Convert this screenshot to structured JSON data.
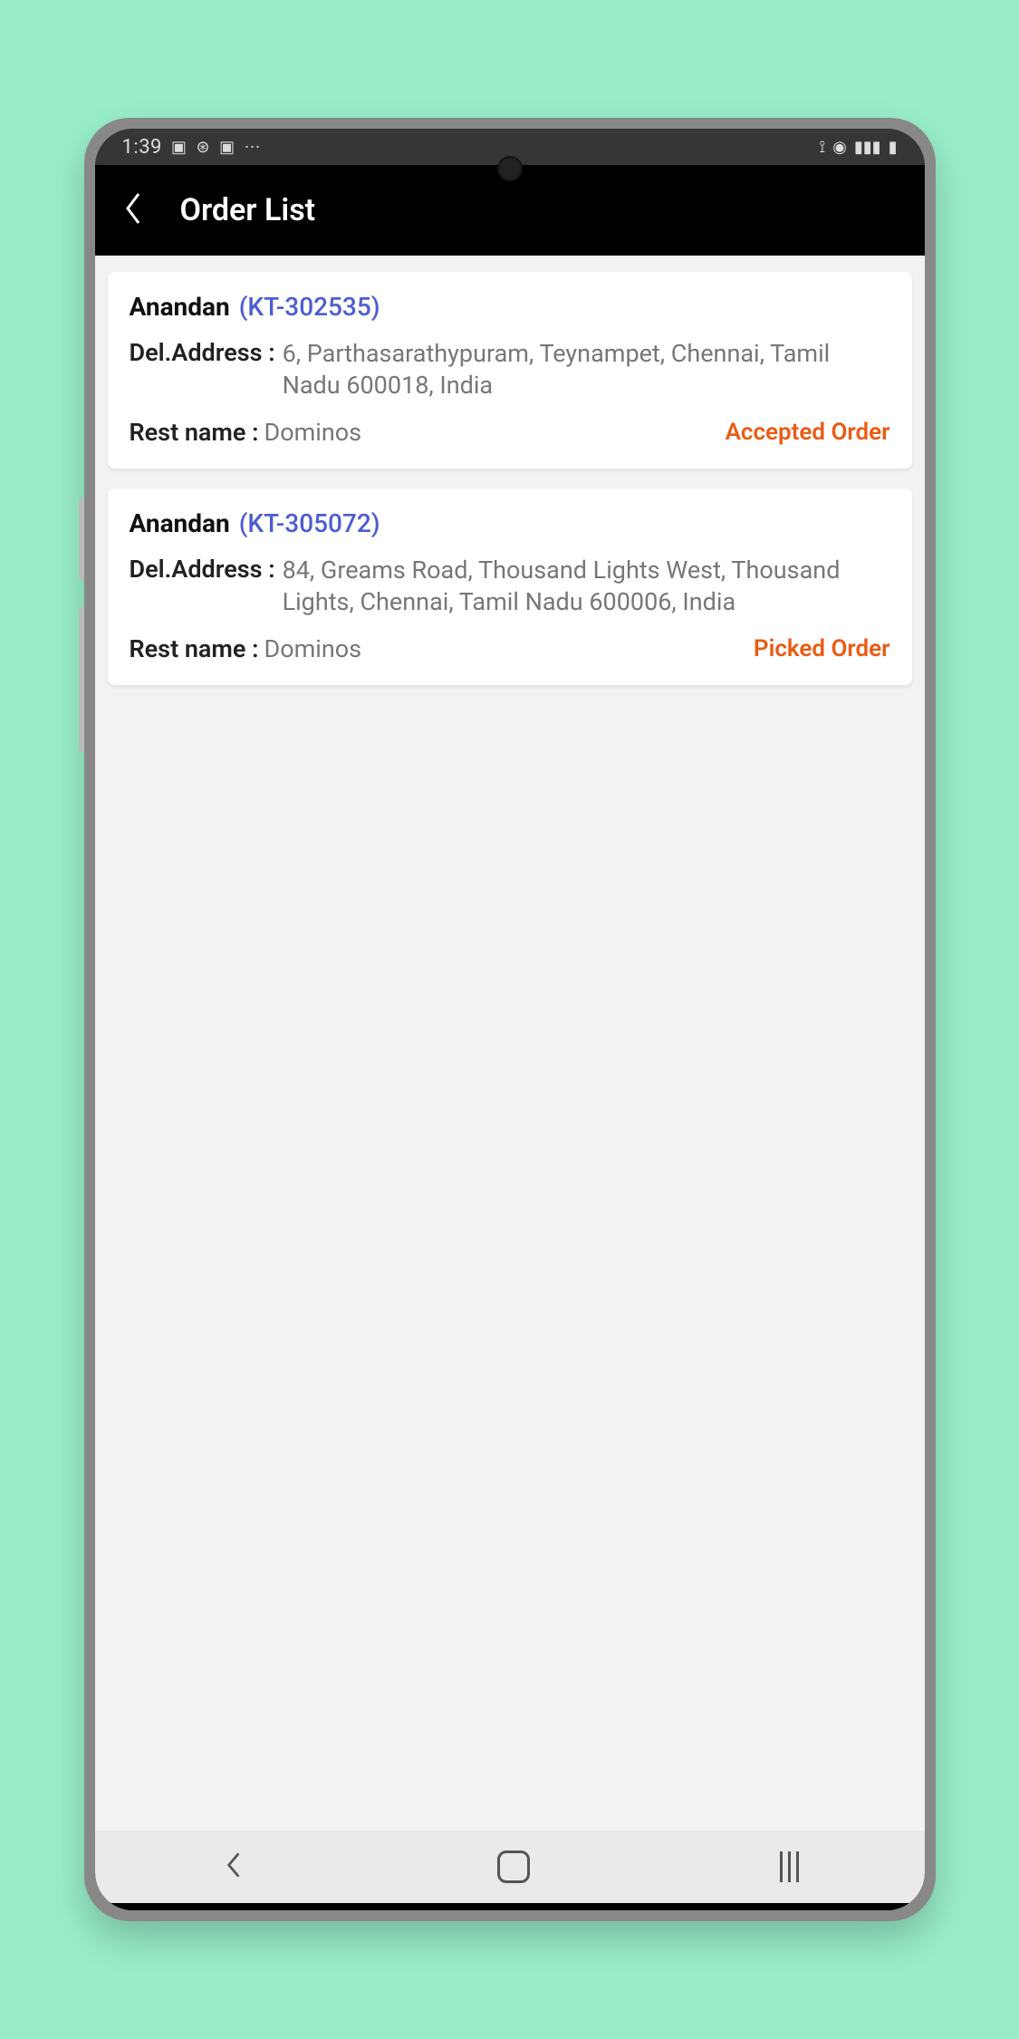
{
  "status_bar": {
    "time": "1:39",
    "dots": "⋯"
  },
  "header": {
    "title": "Order List"
  },
  "labels": {
    "del_address": "Del.Address : ",
    "rest_name": "Rest name : "
  },
  "orders": [
    {
      "customer": "Anandan",
      "id": "(KT-302535)",
      "address": "6, Parthasarathypuram, Teynampet, Chennai, Tamil Nadu 600018, India",
      "restaurant": "Dominos",
      "status": "Accepted Order"
    },
    {
      "customer": "Anandan",
      "id": "(KT-305072)",
      "address": "84, Greams Road, Thousand Lights West, Thousand Lights, Chennai, Tamil Nadu 600006, India",
      "restaurant": "Dominos",
      "status": "Picked Order"
    }
  ]
}
